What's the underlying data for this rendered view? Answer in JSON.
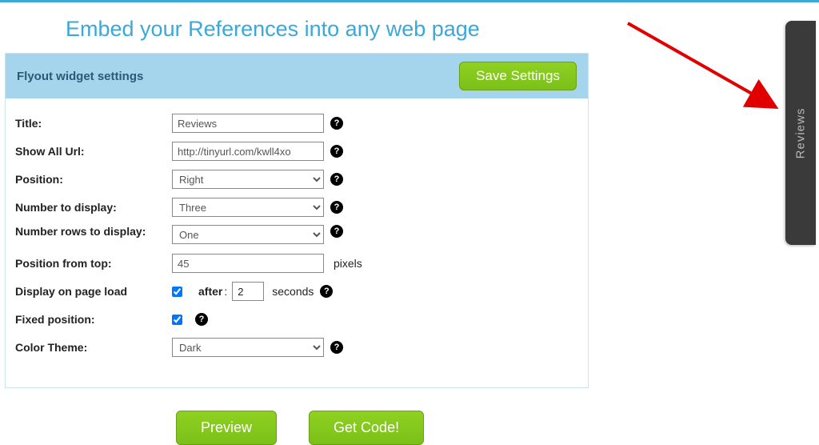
{
  "page": {
    "title": "Embed your References into any web page"
  },
  "panel": {
    "title": "Flyout widget settings",
    "save_label": "Save Settings"
  },
  "fields": {
    "title": {
      "label": "Title:",
      "value": "Reviews"
    },
    "show_all_url": {
      "label": "Show All Url:",
      "value": "http://tinyurl.com/kwll4xo"
    },
    "position": {
      "label": "Position:",
      "value": "Right"
    },
    "num_display": {
      "label": "Number to display:",
      "value": "Three"
    },
    "num_rows": {
      "label": "Number rows to display:",
      "value": "One"
    },
    "pos_top": {
      "label": "Position from top:",
      "value": "45",
      "unit": "pixels"
    },
    "display_load": {
      "label": "Display on page load",
      "checked": true,
      "after_label": "after",
      "after_value": "2",
      "after_unit": "seconds"
    },
    "fixed_position": {
      "label": "Fixed position:",
      "checked": true
    },
    "color_theme": {
      "label": "Color Theme:",
      "value": "Dark"
    }
  },
  "buttons": {
    "preview": "Preview",
    "get_code": "Get Code!"
  },
  "flyout": {
    "tab_label": "Reviews"
  },
  "help_glyph": "?"
}
